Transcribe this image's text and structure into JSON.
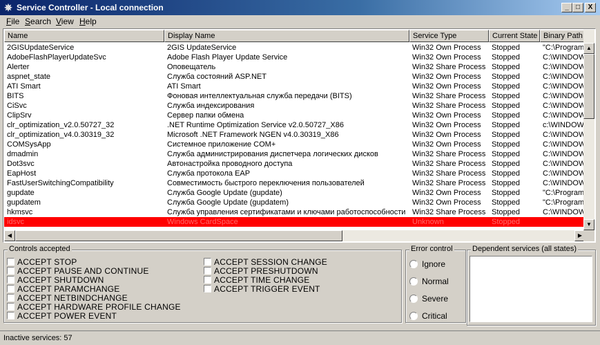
{
  "window": {
    "title": "Service Controller - Local connection",
    "controls": {
      "minimize": "_",
      "maximize": "□",
      "close": "X"
    }
  },
  "menu": [
    {
      "pre": "",
      "key": "F",
      "post": "ile"
    },
    {
      "pre": "",
      "key": "S",
      "post": "earch"
    },
    {
      "pre": "",
      "key": "V",
      "post": "iew"
    },
    {
      "pre": "",
      "key": "H",
      "post": "elp"
    }
  ],
  "columns": [
    "Name",
    "Display Name",
    "Service Type",
    "Current State",
    "Binary Path N"
  ],
  "rows": [
    [
      "2GISUpdateService",
      "2GIS UpdateService",
      "Win32 Own Process",
      "Stopped",
      "\"C:\\Program"
    ],
    [
      "AdobeFlashPlayerUpdateSvc",
      "Adobe Flash Player Update Service",
      "Win32 Own Process",
      "Stopped",
      "C:\\WINDOW"
    ],
    [
      "Alerter",
      "Оповещатель",
      "Win32 Share Process",
      "Stopped",
      "C:\\WINDOW"
    ],
    [
      "aspnet_state",
      "Служба состояний ASP.NET",
      "Win32 Own Process",
      "Stopped",
      "C:\\WINDOW"
    ],
    [
      "ATI Smart",
      "ATI Smart",
      "Win32 Own Process",
      "Stopped",
      "C:\\WINDOW"
    ],
    [
      "BITS",
      "Фоновая интеллектуальная служба передачи (BITS)",
      "Win32 Share Process",
      "Stopped",
      "C:\\WINDOW"
    ],
    [
      "CiSvc",
      "Служба индексирования",
      "Win32 Share Process",
      "Stopped",
      "C:\\WINDOW"
    ],
    [
      "ClipSrv",
      "Сервер папки обмена",
      "Win32 Own Process",
      "Stopped",
      "C:\\WINDOW"
    ],
    [
      "clr_optimization_v2.0.50727_32",
      ".NET Runtime Optimization Service v2.0.50727_X86",
      "Win32 Own Process",
      "Stopped",
      "c:\\WINDOW"
    ],
    [
      "clr_optimization_v4.0.30319_32",
      "Microsoft .NET Framework NGEN v4.0.30319_X86",
      "Win32 Own Process",
      "Stopped",
      "C:\\WINDOW"
    ],
    [
      "COMSysApp",
      "Системное приложение COM+",
      "Win32 Own Process",
      "Stopped",
      "C:\\WINDOW"
    ],
    [
      "dmadmin",
      "Служба администрирования диспетчера логических дисков",
      "Win32 Share Process",
      "Stopped",
      "C:\\WINDOW"
    ],
    [
      "Dot3svc",
      "Автонастройка проводного доступа",
      "Win32 Share Process",
      "Stopped",
      "C:\\WINDOW"
    ],
    [
      "EapHost",
      "Служба протокола EAP",
      "Win32 Share Process",
      "Stopped",
      "C:\\WINDOW"
    ],
    [
      "FastUserSwitchingCompatibility",
      "Совместимость быстрого переключения пользователей",
      "Win32 Share Process",
      "Stopped",
      "C:\\WINDOW"
    ],
    [
      "gupdate",
      "Служба Google Update (gupdate)",
      "Win32 Own Process",
      "Stopped",
      "\"C:\\Program"
    ],
    [
      "gupdatem",
      "Служба Google Update (gupdatem)",
      "Win32 Own Process",
      "Stopped",
      "\"C:\\Program"
    ],
    [
      "hkmsvc",
      "Служба управления сертификатами и ключами работоспособности",
      "Win32 Share Process",
      "Stopped",
      "C:\\WINDOW"
    ],
    [
      "idsvc",
      "Windows CardSpace",
      "Unknown",
      "Stopped",
      ""
    ]
  ],
  "selected_row_index": 18,
  "controls_accepted": {
    "label": "Controls accepted",
    "left": [
      "ACCEPT STOP",
      "ACCEPT PAUSE AND CONTINUE",
      "ACCEPT SHUTDOWN",
      "ACCEPT PARAMCHANGE",
      "ACCEPT NETBINDCHANGE",
      "ACCEPT HARDWARE PROFILE CHANGE",
      "ACCEPT POWER EVENT"
    ],
    "right": [
      "ACCEPT SESSION CHANGE",
      "ACCEPT PRESHUTDOWN",
      "ACCEPT TIME CHANGE",
      "ACCEPT TRIGGER EVENT"
    ]
  },
  "error_control": {
    "label": "Error control",
    "options": [
      "Ignore",
      "Normal",
      "Severe",
      "Critical"
    ]
  },
  "dependent_services": {
    "label": "Dependent services (all states)"
  },
  "status": {
    "text": "Inactive services: 57"
  }
}
